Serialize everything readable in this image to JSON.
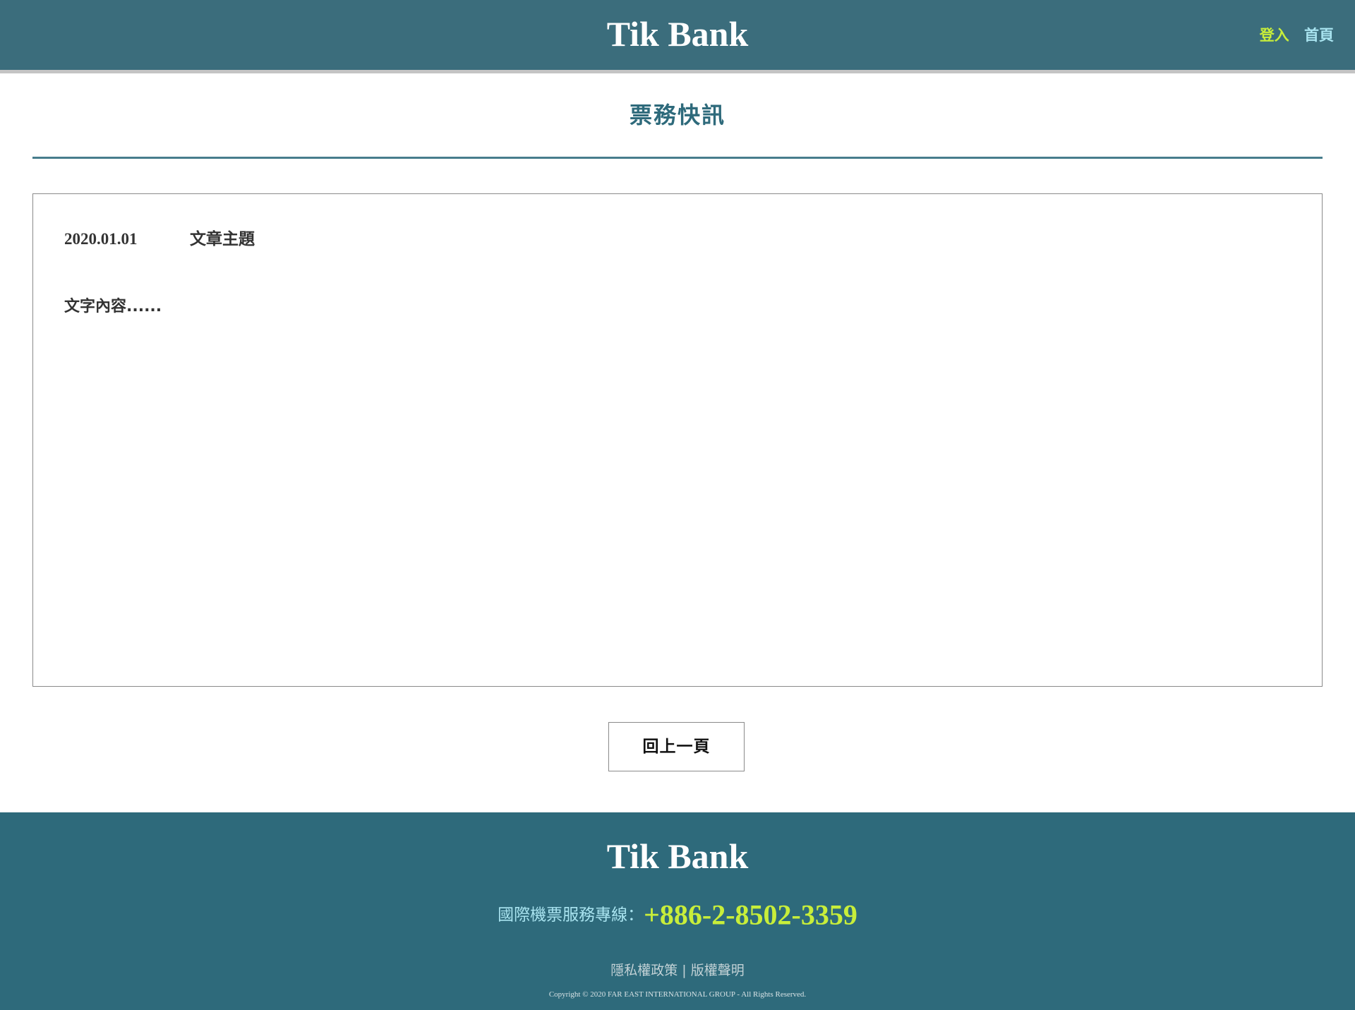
{
  "header": {
    "brand": "Tik Bank",
    "nav": {
      "login": "登入",
      "home": "首頁"
    }
  },
  "page": {
    "title": "票務快訊"
  },
  "article": {
    "date": "2020.01.01",
    "subject": "文章主題",
    "body": "文字內容......"
  },
  "actions": {
    "back_label": "回上一頁"
  },
  "footer": {
    "brand": "Tik Bank",
    "hotline_label": "國際機票服務專線：",
    "hotline_number": "+886-2-8502-3359",
    "privacy_link": "隱私權政策",
    "separator": "|",
    "copyright_link": "版權聲明",
    "copyright_text": "Copyright © 2020 FAR EAST INTERNATIONAL GROUP - All Rights Reserved."
  },
  "colors": {
    "header_bg": "#3b6d7c",
    "footer_bg": "#2e6a7b",
    "accent_green": "#c8ee3a",
    "accent_cyan": "#a9e4f0",
    "title_teal": "#2e6a7b"
  }
}
